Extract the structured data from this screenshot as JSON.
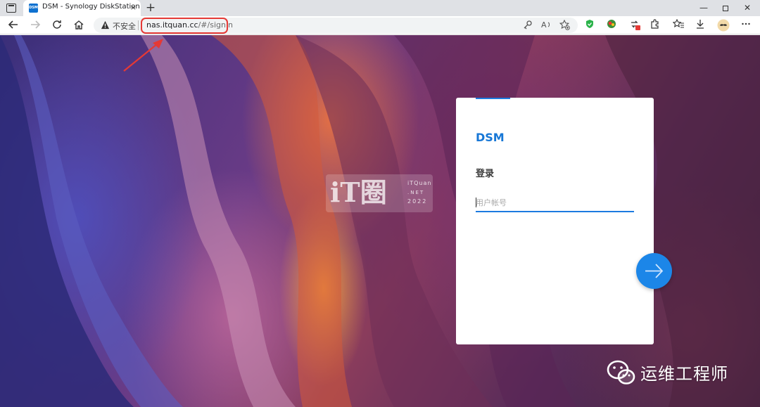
{
  "browser": {
    "tab": {
      "favicon_text": "DSM",
      "title": "DSM - Synology DiskStation",
      "close_glyph": "×"
    },
    "new_tab_glyph": "+",
    "window_controls": {
      "minimize": "—",
      "close": "✕"
    },
    "address": {
      "security_label": "不安全",
      "url_host": "nas.itquan.cc",
      "url_path": "/#/signin"
    },
    "annotation_color": "#e53935"
  },
  "watermark": {
    "main": "iT圈",
    "sub1": "iTQuan",
    "sub2": ".NET",
    "sub3": "2022"
  },
  "login": {
    "brand": "DSM",
    "heading": "登录",
    "username_placeholder": "用户帐号",
    "accent_color": "#1c7be0"
  },
  "footer": {
    "brand": "运维工程师"
  },
  "icons": {
    "back": "back-arrow-icon",
    "forward": "forward-arrow-icon",
    "refresh": "refresh-icon",
    "home": "home-icon",
    "warning": "warning-icon",
    "key": "key-icon",
    "read_aloud": "read-aloud-icon",
    "favorite_add": "favorite-add-icon",
    "shield": "shield-icon",
    "extension": "puzzle-icon",
    "favorites": "favorites-icon",
    "download": "download-icon",
    "more": "more-icon"
  }
}
